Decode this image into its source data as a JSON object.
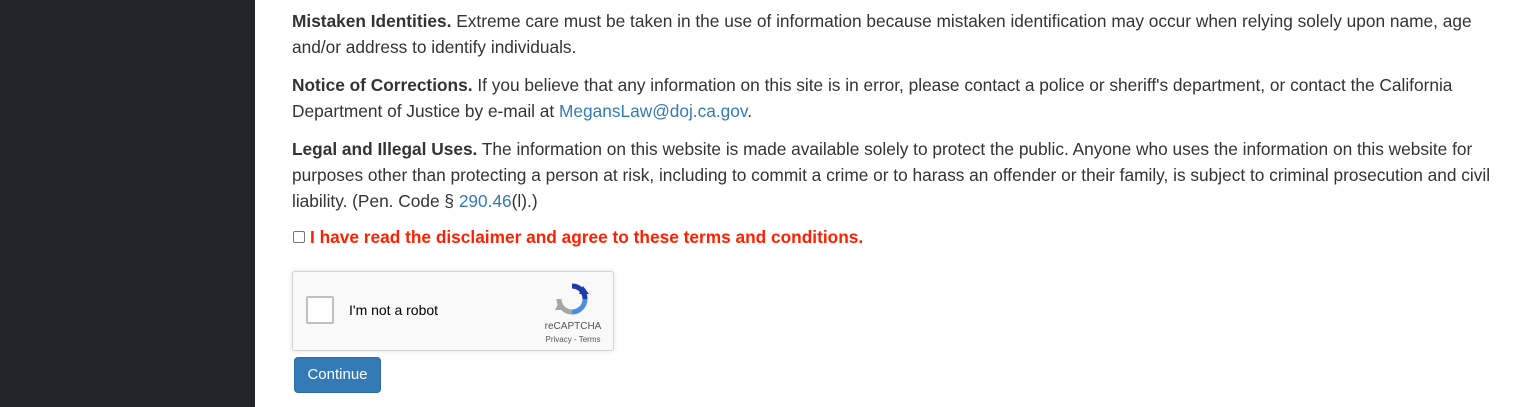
{
  "disclaimer": {
    "mistaken": {
      "heading": "Mistaken Identities.",
      "text": " Extreme care must be taken in the use of information because mistaken identification may occur when relying solely upon name, age and/or address to identify individuals."
    },
    "corrections": {
      "heading": "Notice of Corrections.",
      "text": " If you believe that any information on this site is in error, please contact a police or sheriff's department, or contact the California Department of Justice by e-mail at ",
      "email_link": "MegansLaw@doj.ca.gov",
      "text_end": "."
    },
    "legal": {
      "heading": "Legal and Illegal Uses.",
      "text": " The information on this website is made available solely to protect the public. Anyone who uses the information on this website for purposes other than protecting a person at risk, including to commit a crime or to harass an offender or their family, is subject to criminal prosecution and civil liability. (Pen. Code § ",
      "code_link": "290.46",
      "text_end": "(l).)"
    }
  },
  "agreement": {
    "checked": false,
    "label": "I have read the disclaimer and agree to these terms and conditions."
  },
  "recaptcha": {
    "checked": false,
    "label": "I'm not a robot",
    "brand": "reCAPTCHA",
    "privacy_link": "Privacy",
    "separator": " - ",
    "terms_link": "Terms"
  },
  "continue_button": {
    "label": "Continue"
  },
  "colors": {
    "sidebar": "#212529",
    "link": "#337ab7",
    "warning_text": "#ff2000",
    "button": "#337ab7"
  }
}
